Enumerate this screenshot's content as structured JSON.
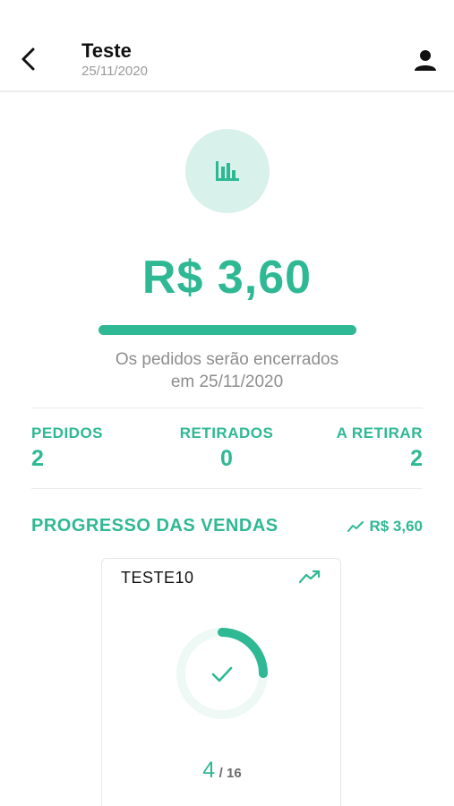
{
  "header": {
    "title": "Teste",
    "date": "25/11/2020",
    "back_icon": "chevron-left-icon",
    "user_icon": "user-icon"
  },
  "summary": {
    "icon": "bar-chart-icon",
    "amount": "R$ 3,60",
    "progress": 1.0,
    "notice_line1": "Os pedidos serão encerrados",
    "notice_line2": "em 25/11/2020"
  },
  "stats": [
    {
      "label": "PEDIDOS",
      "value": "2"
    },
    {
      "label": "RETIRADOS",
      "value": "0"
    },
    {
      "label": "A RETIRAR",
      "value": "2"
    }
  ],
  "sales_progress": {
    "title": "PROGRESSO DAS VENDAS",
    "total": "R$ 3,60",
    "trend_icon": "trending-up-icon"
  },
  "products": [
    {
      "name": "TESTE10",
      "sold": "4",
      "total": "/ 16",
      "fraction": 0.25,
      "status_icon": "check-icon"
    }
  ],
  "colors": {
    "accent": "#2fb894",
    "accent_light": "#d8f1ea",
    "ring_track": "#eef9f5",
    "muted_text": "#8d8d8d"
  }
}
